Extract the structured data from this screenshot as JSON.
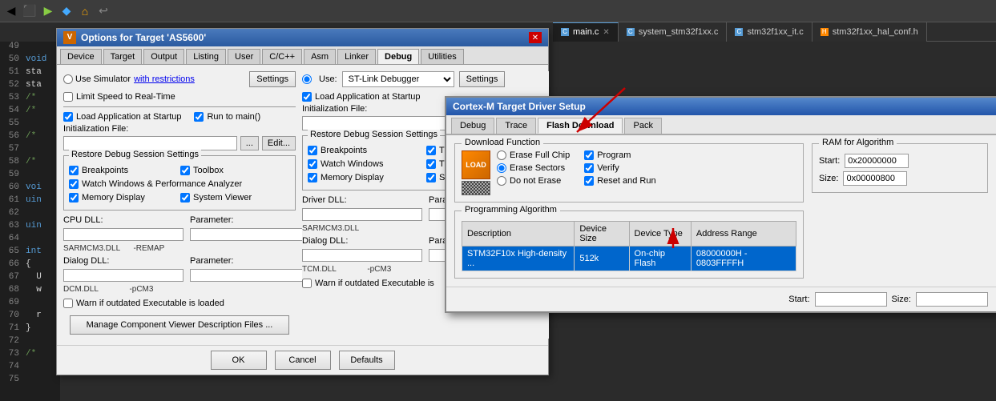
{
  "toolbar": {
    "icons": [
      "◀",
      "⏹",
      "▶",
      "◆",
      "🏠",
      "↩"
    ]
  },
  "fileTabs": [
    {
      "label": "main.c",
      "active": true,
      "icon": "C"
    },
    {
      "label": "system_stm32f1xx.c",
      "active": false,
      "icon": "C"
    },
    {
      "label": "stm32f1xx_it.c",
      "active": false,
      "icon": "C"
    },
    {
      "label": "stm32f1xx_hal_conf.h",
      "active": false,
      "icon": "H"
    }
  ],
  "optionsDialog": {
    "title": "Options for Target 'AS5600'",
    "tabs": [
      "Device",
      "Target",
      "Output",
      "Listing",
      "User",
      "C/C++",
      "Asm",
      "Linker",
      "Debug",
      "Utilities"
    ],
    "activeTab": "Debug",
    "leftPanel": {
      "useSimulator": "Use Simulator",
      "withRestrictions": "with restrictions",
      "settingsBtn": "Settings",
      "limitSpeed": "Limit Speed to Real-Time",
      "loadApp": "Load Application at Startup",
      "runToMain": "Run to main()",
      "initFile": "Initialization File:",
      "editBtn": "Edit...",
      "browseBtn": "...",
      "restoreSection": "Restore Debug Session Settings",
      "breakpoints": "Breakpoints",
      "toolbox": "Toolbox",
      "watchWindows": "Watch Windows & Performance Analyzer",
      "memoryDisplay": "Memory Display",
      "systemViewer": "System Viewer",
      "cpuDLL": "CPU DLL:",
      "cpuParam": "Parameter:",
      "cpuDLLVal": "SARMCM3.DLL",
      "cpuParamVal": "-REMAP",
      "dialogDLL": "Dialog DLL:",
      "dialogParam": "Parameter:",
      "dialogDLLVal": "DCM.DLL",
      "dialogParamVal": "-pCM3",
      "warnOutdated": "Warn if outdated Executable is loaded",
      "manageBtn": "Manage Component Viewer Description Files ..."
    },
    "rightPanel": {
      "useLabel": "Use:",
      "useValue": "ST-Link Debugger",
      "settingsBtn": "Settings",
      "loadApp": "Load Application at Startup",
      "initFile": "Initialization File:",
      "restoreSection": "Restore Debug Session Settings",
      "breakpoints": "Breakpoints",
      "watchWindows": "Watch Windows",
      "memoryDisplay": "Memory Display",
      "driverDLL": "Driver DLL:",
      "driverParam": "Parameter:",
      "driverDLLVal": "SARMCM3.DLL",
      "dialogDLL": "Dialog DLL:",
      "dialogParam": "Parameter:",
      "dialogDLLVal": "TCM.DLL",
      "dialogParamVal": "-pCM3",
      "warnOutdated": "Warn if outdated Executable is"
    },
    "buttons": {
      "ok": "OK",
      "cancel": "Cancel",
      "defaults": "Defaults"
    }
  },
  "cortexDialog": {
    "title": "Cortex-M Target Driver Setup",
    "tabs": [
      "Debug",
      "Trace",
      "Flash Download",
      "Pack"
    ],
    "activeTab": "Flash Download",
    "downloadFunction": {
      "groupTitle": "Download Function",
      "eraseFullChip": "Erase Full Chip",
      "eraseSectors": "Erase Sectors",
      "doNotErase": "Do not Erase",
      "program": "Program",
      "verify": "Verify",
      "resetAndRun": "Reset and Run"
    },
    "ramForAlgorithm": {
      "groupTitle": "RAM for Algorithm",
      "startLabel": "Start:",
      "startValue": "0x20000000",
      "sizeLabel": "Size:",
      "sizeValue": "0x00000800"
    },
    "programmingAlgorithm": {
      "groupTitle": "Programming Algorithm",
      "columns": [
        "Description",
        "Device Size",
        "Device Type",
        "Address Range"
      ],
      "rows": [
        {
          "description": "STM32F10x High-density ...",
          "deviceSize": "512k",
          "deviceType": "On-chip Flash",
          "addressRange": "08000000H - 0803FFFFH"
        }
      ]
    },
    "bottom": {
      "startLabel": "Start:",
      "sizeLabel": "Size:"
    }
  },
  "codeLines": [
    {
      "num": "49",
      "content": ""
    },
    {
      "num": "50",
      "content": "void"
    },
    {
      "num": "51",
      "content": "sta"
    },
    {
      "num": "52",
      "content": "sta"
    },
    {
      "num": "53",
      "content": "/*"
    },
    {
      "num": "54",
      "content": "/*"
    },
    {
      "num": "55",
      "content": ""
    },
    {
      "num": "56",
      "content": "/*"
    },
    {
      "num": "57",
      "content": ""
    },
    {
      "num": "58",
      "content": "/*"
    },
    {
      "num": "59",
      "content": ""
    },
    {
      "num": "60",
      "content": "voi"
    },
    {
      "num": "61",
      "content": "uin"
    },
    {
      "num": "62",
      "content": ""
    },
    {
      "num": "63",
      "content": "uin"
    },
    {
      "num": "64",
      "content": ""
    },
    {
      "num": "65",
      "content": "int"
    },
    {
      "num": "66",
      "content": "{"
    },
    {
      "num": "67",
      "content": "  U"
    },
    {
      "num": "68",
      "content": "  w"
    },
    {
      "num": "69",
      "content": ""
    },
    {
      "num": "70",
      "content": "  r"
    },
    {
      "num": "71",
      "content": "}"
    },
    {
      "num": "72",
      "content": ""
    },
    {
      "num": "73",
      "content": "/*"
    },
    {
      "num": "74",
      "content": ""
    },
    {
      "num": "75",
      "content": ""
    }
  ]
}
